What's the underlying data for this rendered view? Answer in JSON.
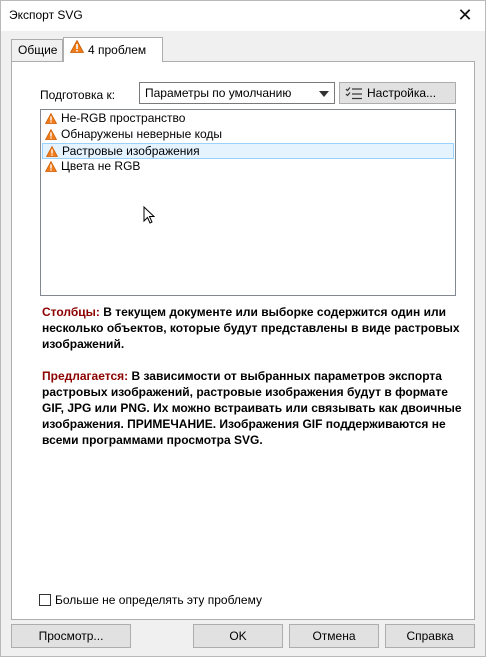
{
  "window": {
    "title": "Экспорт SVG"
  },
  "tabs": [
    {
      "label": "Общие"
    },
    {
      "label": "4 проблем"
    }
  ],
  "prep": {
    "label": "Подготовка к:",
    "selected": "Параметры по умолчанию",
    "setup_label": "Настройка..."
  },
  "problems": [
    {
      "label": "Не-RGB пространство",
      "icon": "warning-icon",
      "selected": false
    },
    {
      "label": "Обнаружены неверные коды",
      "icon": "warning-icon",
      "selected": false
    },
    {
      "label": "Растровые изображения",
      "icon": "warning-icon",
      "selected": true
    },
    {
      "label": "Цвета не RGB",
      "icon": "warning-icon",
      "selected": false
    }
  ],
  "description": {
    "issue_keyword": "Столбцы:",
    "issue_text": " В текущем документе или выборке содержится один или несколько объектов, которые будут представлены в виде растровых изображений.",
    "suggest_keyword": "Предлагается:",
    "suggest_text": " В зависимости от выбранных параметров экспорта растровых изображений, растровые изображения будут в формате GIF, JPG или PNG. Их можно встраивать или связывать как двоичные изображения. ПРИМЕЧАНИЕ. Изображения GIF поддерживаются не всеми программами просмотра SVG."
  },
  "checkbox": {
    "label": "Больше не определять эту проблему",
    "checked": false
  },
  "buttons": {
    "preview": "Просмотр...",
    "ok": "OK",
    "cancel": "Отмена",
    "help": "Справка"
  },
  "colors": {
    "warning": "#f07c1c",
    "keyword": "#8b0000",
    "selection_bg": "#e5f3ff",
    "selection_border": "#99d1ff"
  }
}
